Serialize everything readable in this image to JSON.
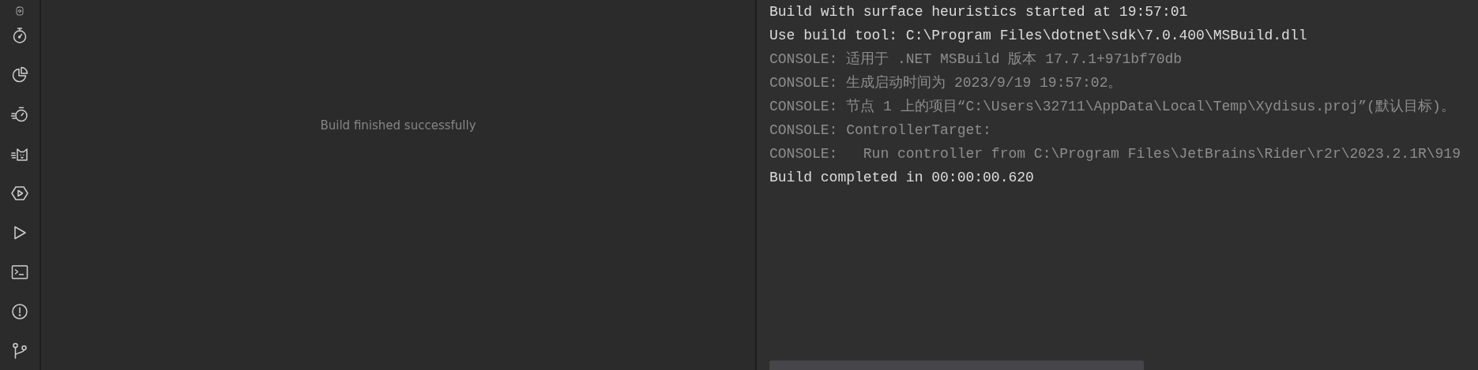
{
  "build_panel": {
    "status": "Build finished successfully"
  },
  "console": {
    "lines": [
      {
        "kind": "output",
        "text": "Build with surface heuristics started at 19:57:01"
      },
      {
        "kind": "output",
        "text": "Use build tool: C:\\Program Files\\dotnet\\sdk\\7.0.400\\MSBuild.dll"
      },
      {
        "kind": "console",
        "text": "CONSOLE: 适用于 .NET MSBuild 版本 17.7.1+971bf70db"
      },
      {
        "kind": "console",
        "text": "CONSOLE: 生成启动时间为 2023/9/19 19:57:02。"
      },
      {
        "kind": "console",
        "text": "CONSOLE: 节点 1 上的项目“C:\\Users\\32711\\AppData\\Local\\Temp\\Xydisus.proj”(默认目标)。"
      },
      {
        "kind": "console",
        "text": "CONSOLE: ControllerTarget:"
      },
      {
        "kind": "console",
        "text": "CONSOLE:   Run controller from C:\\Program Files\\JetBrains\\Rider\\r2r\\2023.2.1R\\919"
      },
      {
        "kind": "output",
        "text": "Build completed in 00:00:00.620"
      }
    ]
  }
}
